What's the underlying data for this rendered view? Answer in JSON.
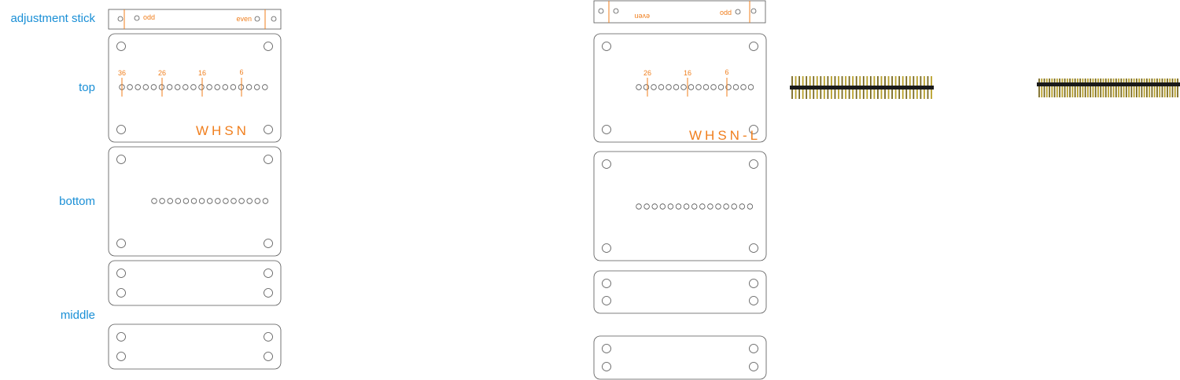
{
  "labels": {
    "adjustment_stick": "adjustment stick",
    "top": "top",
    "bottom": "bottom",
    "middle": "middle"
  },
  "left": {
    "stick_left": "odd",
    "stick_right": "even",
    "pin_labels": [
      "36",
      "26",
      "16",
      "6"
    ],
    "name": "WHSN"
  },
  "right": {
    "stick_left": "even",
    "stick_right": "odd",
    "pin_labels": [
      "26",
      "16",
      "6"
    ],
    "name": "WHSN-L"
  },
  "colors": {
    "outline": "#555555",
    "accent": "#f07f1e",
    "label": "#1a8fd6",
    "header_bar": "#1a1a1a",
    "pin": "#b8a02a"
  }
}
